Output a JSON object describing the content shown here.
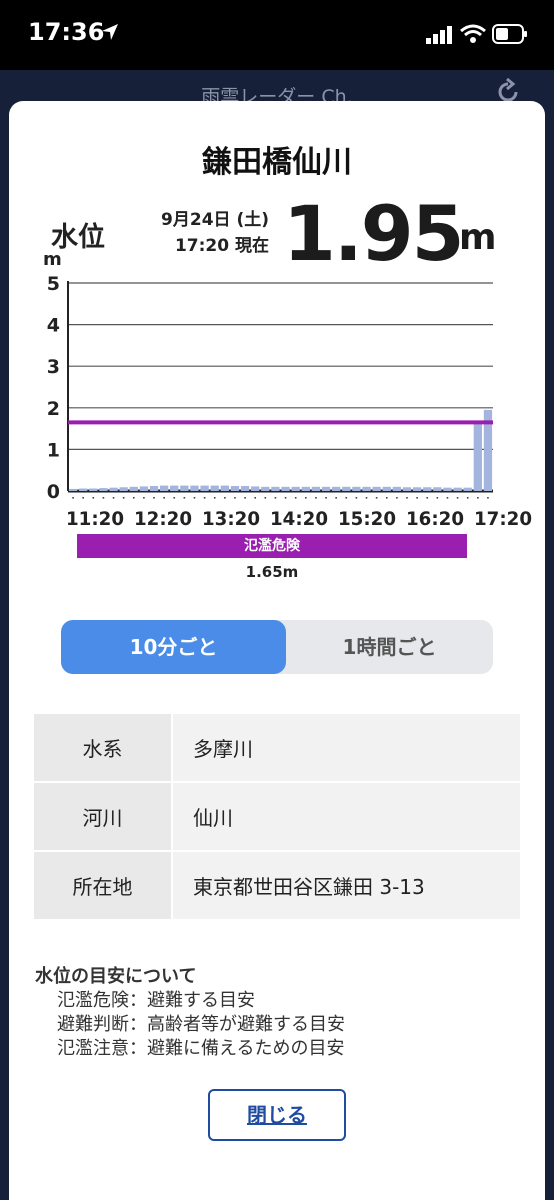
{
  "status_bar": {
    "time": "17:36"
  },
  "background": {
    "app_title": "雨雲レーダー Ch."
  },
  "modal": {
    "station_name": "鎌田橋仙川",
    "water_level_label": "水位",
    "unit": "m",
    "observed_date": "9月24日 (土)",
    "observed_time": "17:20 現在",
    "current_value": "1.95",
    "value_unit": "m"
  },
  "chart_data": {
    "type": "bar",
    "ylabel": "m",
    "ylim": [
      0,
      5
    ],
    "yticks": [
      "0",
      "1",
      "2",
      "3",
      "4",
      "5"
    ],
    "xtick_labels": [
      "11:20",
      "12:20",
      "13:20",
      "14:20",
      "15:20",
      "16:20",
      "17:20"
    ],
    "values": [
      0.05,
      0.06,
      0.06,
      0.07,
      0.08,
      0.09,
      0.1,
      0.11,
      0.12,
      0.13,
      0.13,
      0.13,
      0.13,
      0.13,
      0.13,
      0.13,
      0.12,
      0.12,
      0.11,
      0.1,
      0.1,
      0.1,
      0.1,
      0.1,
      0.1,
      0.1,
      0.1,
      0.1,
      0.1,
      0.1,
      0.1,
      0.1,
      0.1,
      0.09,
      0.09,
      0.09,
      0.09,
      0.08,
      0.08,
      0.08,
      1.65,
      1.95
    ],
    "threshold": {
      "label": "氾濫危険",
      "value": 1.65,
      "value_label": "1.65m",
      "color": "#9a1eb0"
    },
    "bar_color": "#a3b5de",
    "grid": true
  },
  "toggle": {
    "option_10min": "10分ごと",
    "option_1hour": "1時間ごと",
    "selected": "10分ごと"
  },
  "info": [
    {
      "key": "水系",
      "value": "多摩川"
    },
    {
      "key": "河川",
      "value": "仙川"
    },
    {
      "key": "所在地",
      "value": "東京都世田谷区鎌田 3-13"
    }
  ],
  "notes": {
    "title": "水位の目安について",
    "items": [
      "氾濫危険：避難する目安",
      "避難判断：高齢者等が避難する目安",
      "氾濫注意：避難に備えるための目安"
    ]
  },
  "close_button": "閉じる"
}
